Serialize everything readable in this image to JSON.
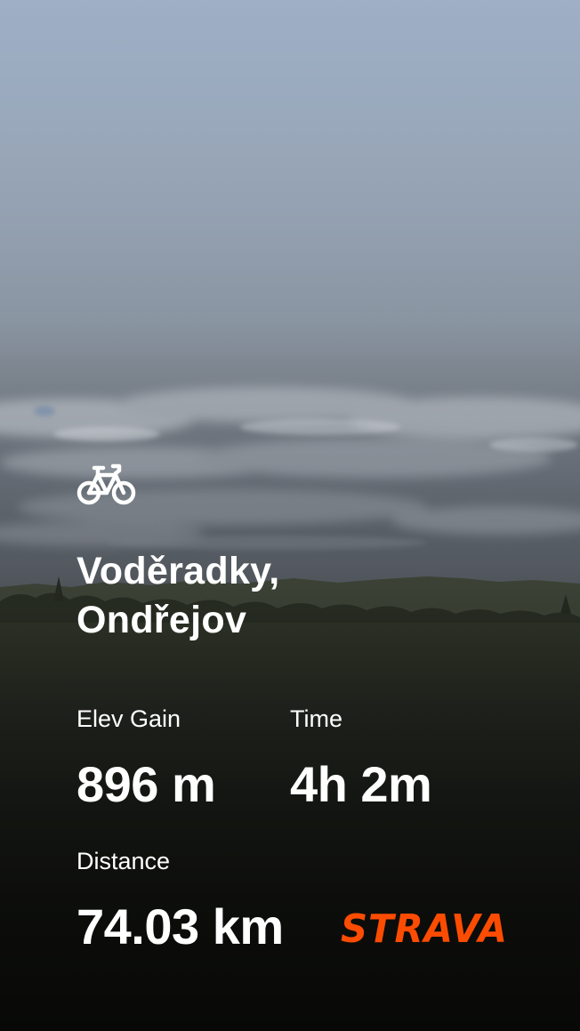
{
  "activity": {
    "type_icon": "bike-icon",
    "title_line1": "Voděradky,",
    "title_line2": "Ondřejov"
  },
  "stats": {
    "elev_gain": {
      "label": "Elev Gain",
      "value": "896 m"
    },
    "time": {
      "label": "Time",
      "value": "4h 2m"
    },
    "distance": {
      "label": "Distance",
      "value": "74.03 km"
    }
  },
  "brand": {
    "name": "STRAVA",
    "color": "#fc4c02"
  },
  "colors": {
    "text": "#ffffff",
    "sky_top": "#9eafc6",
    "ground": "#14150f"
  }
}
